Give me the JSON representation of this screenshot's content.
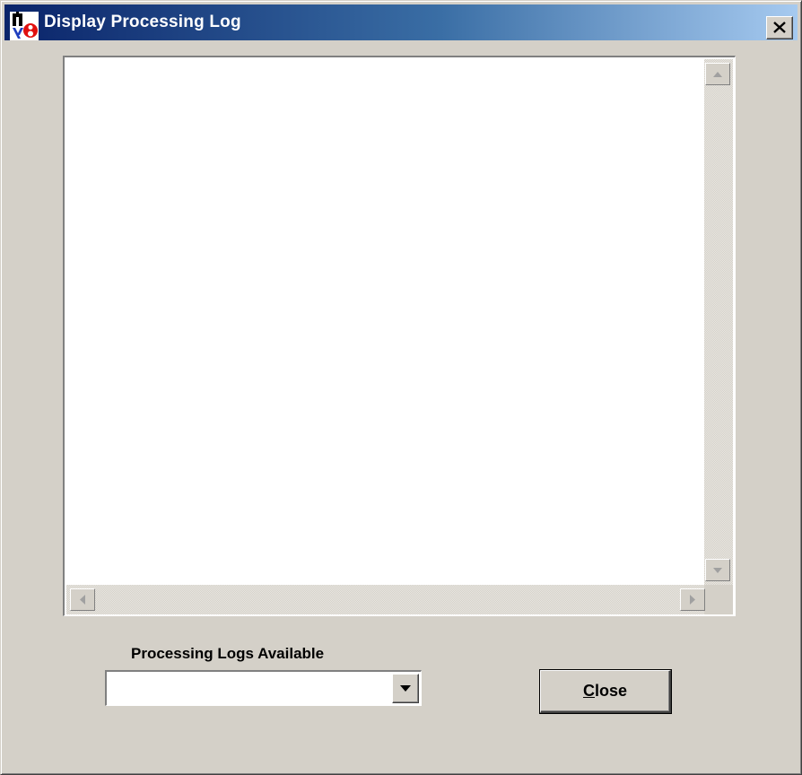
{
  "window": {
    "title": "Display Processing Log",
    "icon": "app-icon",
    "close_icon": "close-icon",
    "titlebar_colors": [
      "#0a246a",
      "#a6caf0"
    ]
  },
  "log": {
    "content": ""
  },
  "logs_selector": {
    "label": "Processing Logs Available",
    "selected_value": "",
    "arrow_icon": "chevron-down-icon"
  },
  "close_button": {
    "accelerator": "C",
    "rest": "lose"
  }
}
